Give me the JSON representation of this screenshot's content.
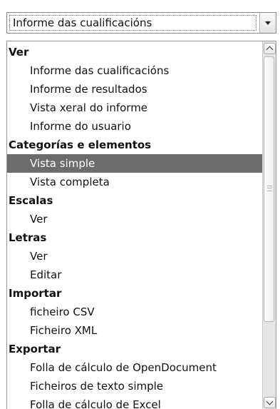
{
  "dropdown": {
    "selected_value": "Informe das cualificacións",
    "arrow_icon": "chevron-down-icon"
  },
  "list": {
    "items": [
      {
        "type": "group",
        "label": "Ver"
      },
      {
        "type": "option",
        "label": "Informe das cualificacións"
      },
      {
        "type": "option",
        "label": "Informe de resultados"
      },
      {
        "type": "option",
        "label": "Vista xeral do informe"
      },
      {
        "type": "option",
        "label": "Informe do usuario"
      },
      {
        "type": "group",
        "label": "Categorías e elementos"
      },
      {
        "type": "option",
        "label": "Vista simple",
        "selected": true
      },
      {
        "type": "option",
        "label": "Vista completa"
      },
      {
        "type": "group",
        "label": "Escalas"
      },
      {
        "type": "option",
        "label": "Ver"
      },
      {
        "type": "group",
        "label": "Letras"
      },
      {
        "type": "option",
        "label": "Ver"
      },
      {
        "type": "option",
        "label": "Editar"
      },
      {
        "type": "group",
        "label": "Importar"
      },
      {
        "type": "option",
        "label": "ficheiro CSV"
      },
      {
        "type": "option",
        "label": "Ficheiro XML"
      },
      {
        "type": "group",
        "label": "Exportar"
      },
      {
        "type": "option",
        "label": "Folla de cálculo de OpenDocument"
      },
      {
        "type": "option",
        "label": "Ficheiros de texto simple"
      },
      {
        "type": "option",
        "label": "Folla de cálculo de Excel"
      }
    ]
  },
  "scrollbar": {
    "up_icon": "chevron-up-icon",
    "down_icon": "chevron-down-icon",
    "thumb_position_fraction": 0.0
  },
  "colors": {
    "selected_background": "#6c6c6c",
    "selected_text": "#ffffff"
  }
}
